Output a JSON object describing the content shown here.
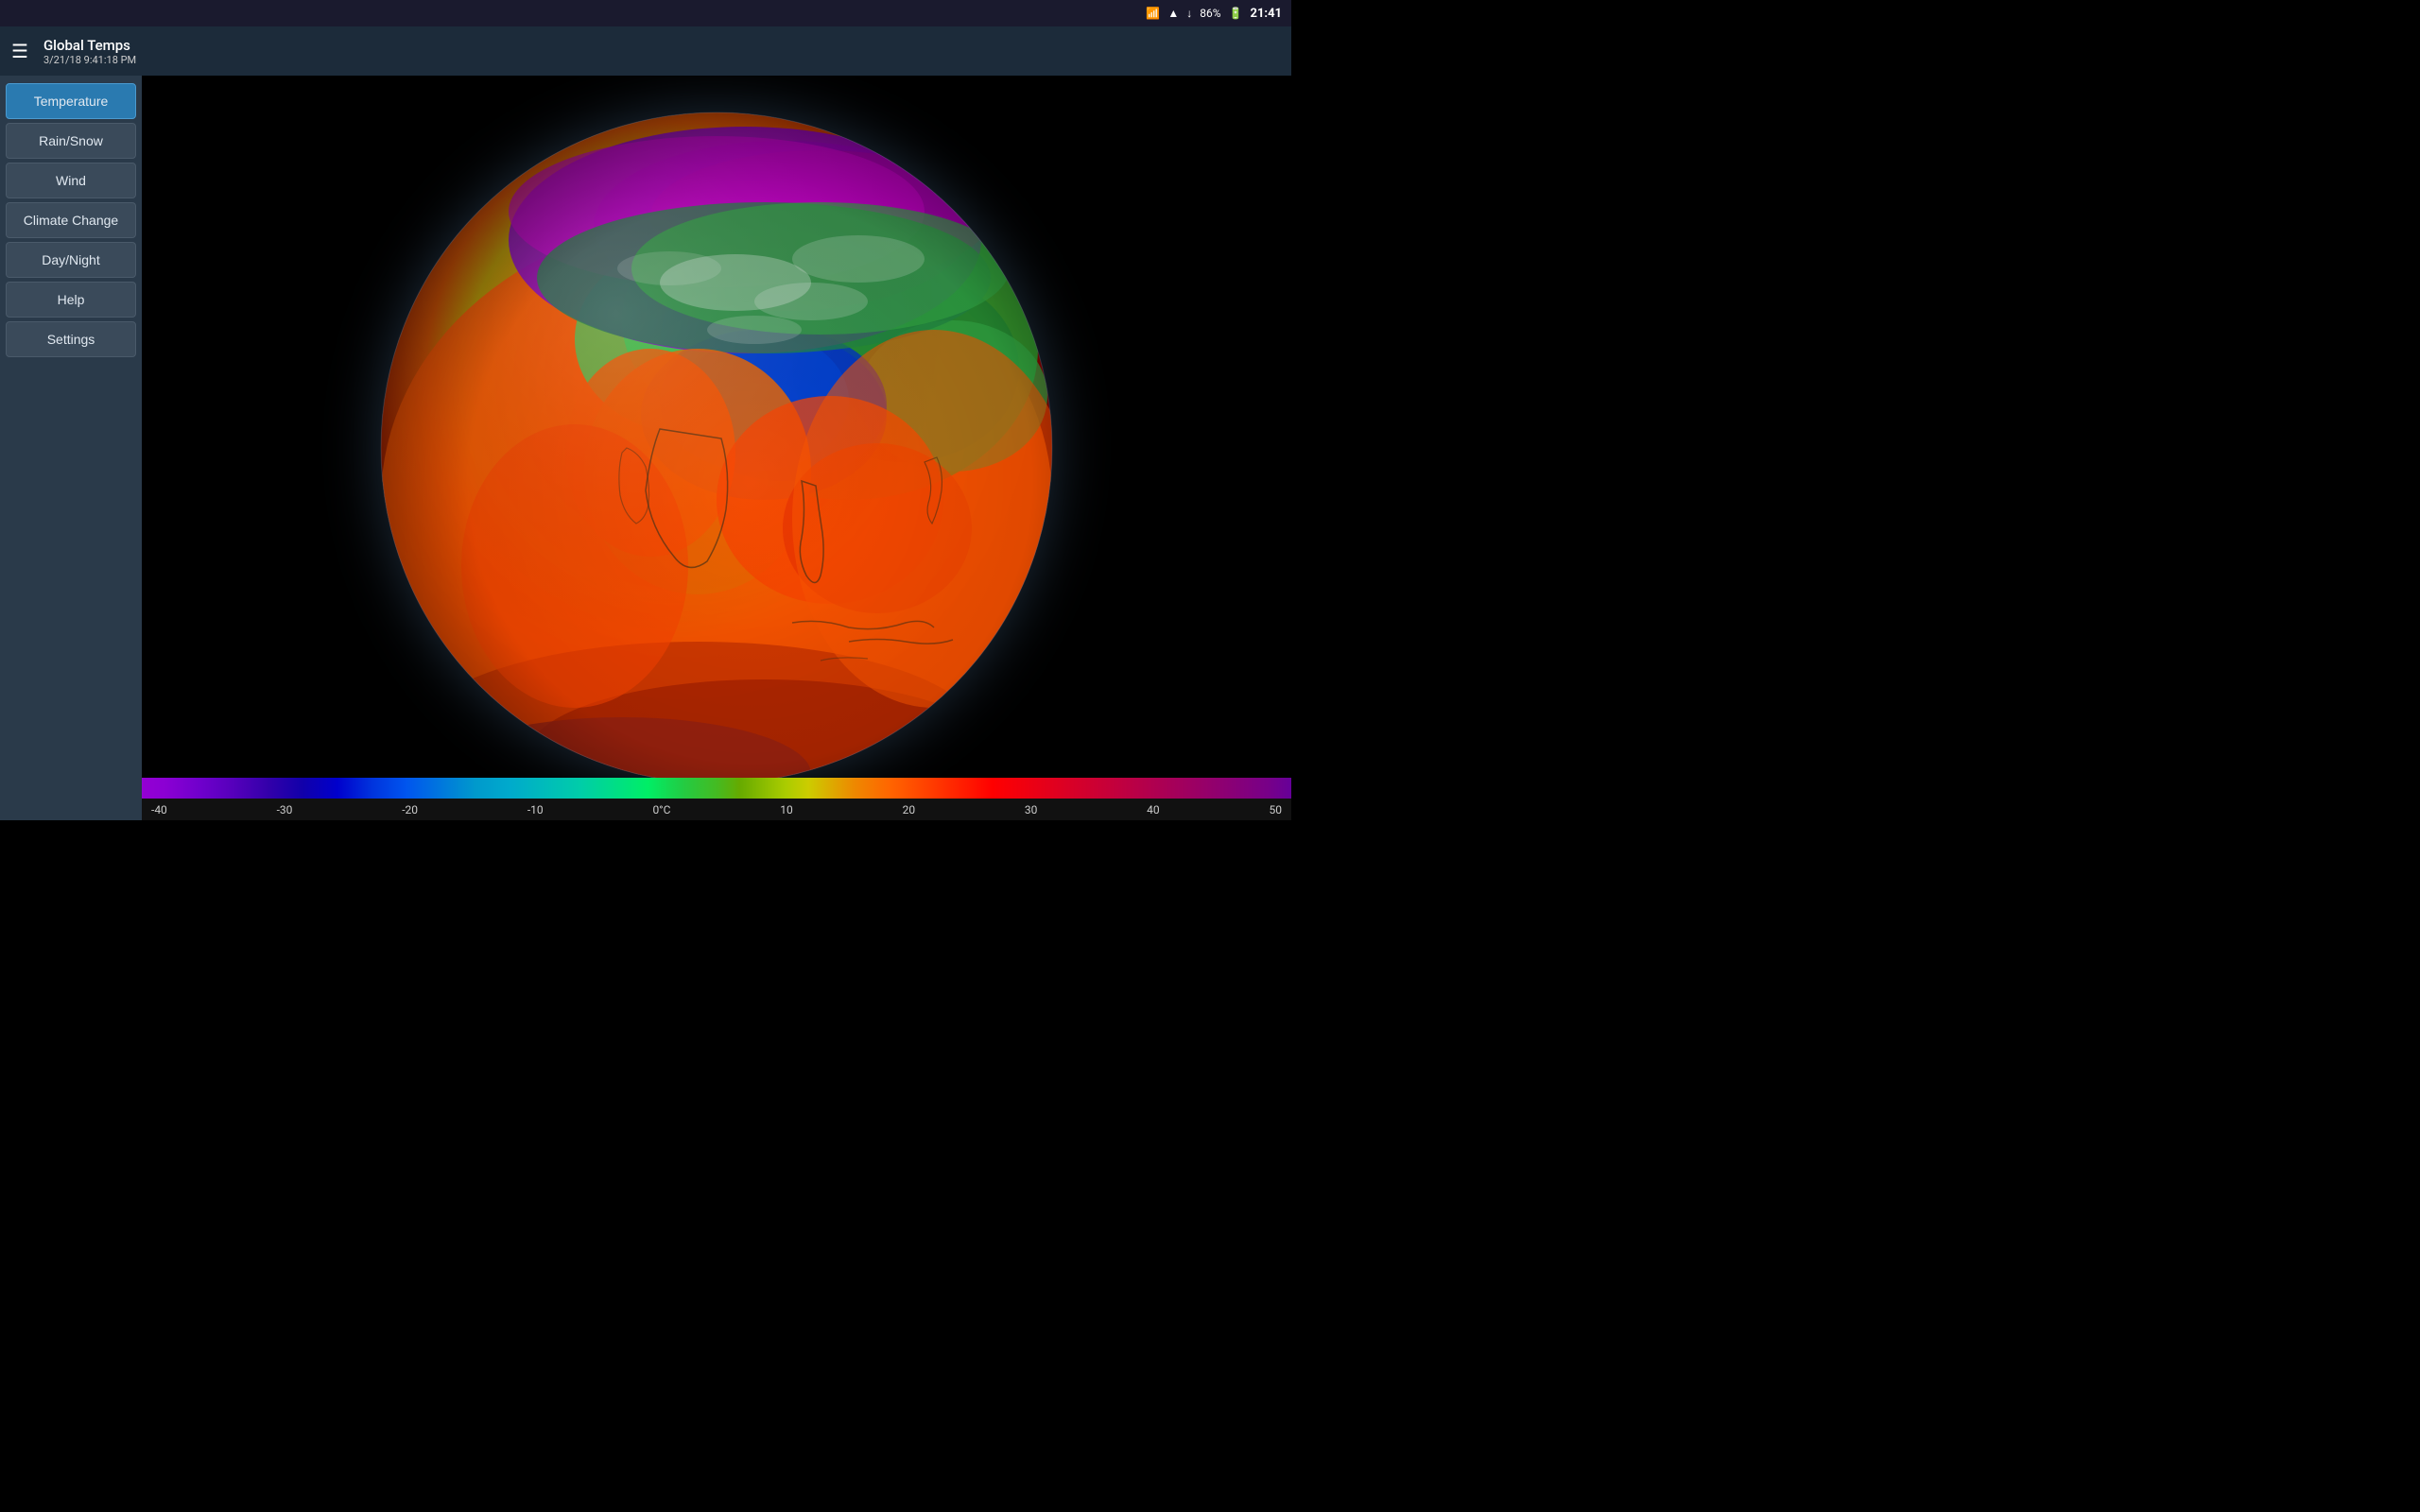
{
  "statusBar": {
    "time": "21:41",
    "battery": "86%",
    "icons": [
      "bluetooth",
      "wifi",
      "download",
      "battery"
    ]
  },
  "titleBar": {
    "appTitle": "Global Temps",
    "appSubtitle": "3/21/18 9:41:18 PM",
    "menuIcon": "☰"
  },
  "sidebar": {
    "items": [
      {
        "label": "Temperature",
        "active": true
      },
      {
        "label": "Rain/Snow",
        "active": false
      },
      {
        "label": "Wind",
        "active": false
      },
      {
        "label": "Climate Change",
        "active": false
      },
      {
        "label": "Day/Night",
        "active": false
      },
      {
        "label": "Help",
        "active": false
      },
      {
        "label": "Settings",
        "active": false
      }
    ]
  },
  "colorScale": {
    "labels": [
      "-40",
      "-30",
      "-20",
      "-10",
      "0°C",
      "10",
      "20",
      "30",
      "40",
      "50"
    ]
  }
}
